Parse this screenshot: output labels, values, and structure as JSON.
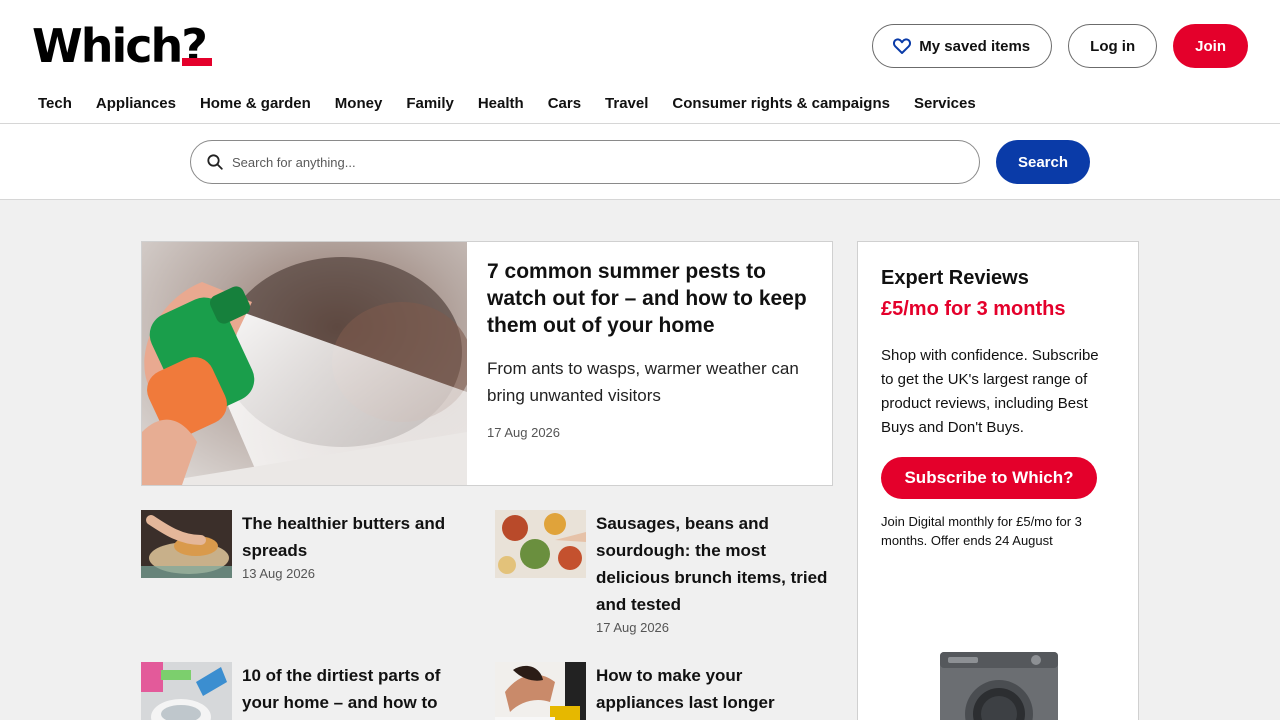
{
  "header": {
    "logo_text": "Which?",
    "saved_label": "My saved items",
    "login_label": "Log in",
    "join_label": "Join"
  },
  "nav": {
    "items": [
      "Tech",
      "Appliances",
      "Home & garden",
      "Money",
      "Family",
      "Health",
      "Cars",
      "Travel",
      "Consumer rights & campaigns",
      "Services"
    ]
  },
  "search": {
    "placeholder": "Search for anything...",
    "value": "",
    "button_label": "Search"
  },
  "featured": {
    "title": "7 common summer pests to watch out for – and how to keep them out of your home",
    "subtitle": "From ants to wasps, warmer weather can bring unwanted visitors",
    "date": "17 Aug 2026"
  },
  "articles": [
    {
      "title": "The healthier butters and spreads",
      "date": "13 Aug 2026"
    },
    {
      "title": "Sausages, beans and sourdough: the most delicious brunch items, tried and tested",
      "date": "17 Aug 2026"
    },
    {
      "title": "10 of the dirtiest parts of your home – and how to",
      "date": ""
    },
    {
      "title": "How to make your appliances last longer",
      "date": ""
    }
  ],
  "promo": {
    "title": "Expert Reviews",
    "price": "£5/mo for 3 months",
    "text": "Shop with confidence. Subscribe to get the UK's largest range of product reviews, including Best Buys and Don't Buys.",
    "button_label": "Subscribe to Which?",
    "small_print": "Join Digital monthly for £5/mo for 3 months. Offer ends 24 August"
  },
  "colors": {
    "brand_red": "#e4002b",
    "search_blue": "#0a3ba8",
    "page_bg": "#f0f0f0"
  },
  "icons": [
    "heart-icon",
    "search-icon"
  ]
}
